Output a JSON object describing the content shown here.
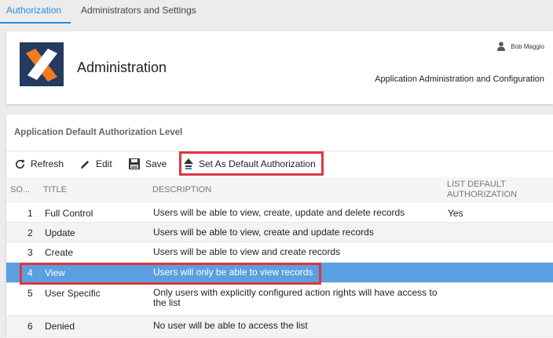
{
  "tabs": [
    {
      "label": "Authorization",
      "active": true
    },
    {
      "label": "Administrators and Settings",
      "active": false
    }
  ],
  "header": {
    "title": "Administration",
    "user": "Bob Maggio",
    "subtitle": "Application Administration and Configuration",
    "logo": {
      "background": "#243a5e",
      "accent": "#f47a20"
    }
  },
  "section": {
    "title": "Application Default Authorization Level"
  },
  "toolbar": {
    "refresh": "Refresh",
    "edit": "Edit",
    "save": "Save",
    "set_default": "Set As Default Authorization"
  },
  "table": {
    "columns": {
      "so": "SO...",
      "title": "TITLE",
      "description": "DESCRIPTION",
      "list_default_1": "LIST DEFAULT",
      "list_default_2": "AUTHORIZATION"
    },
    "rows": [
      {
        "so": "1",
        "title": "Full Control",
        "description": "Users will be able to view, create, update and delete records",
        "list_default": "Yes"
      },
      {
        "so": "2",
        "title": "Update",
        "description": "Users will be able to view, create and update records",
        "list_default": ""
      },
      {
        "so": "3",
        "title": "Create",
        "description": "Users will be able to view and create records",
        "list_default": ""
      },
      {
        "so": "4",
        "title": "View",
        "description": "Users will only be able to view records",
        "list_default": "",
        "selected": true
      },
      {
        "so": "5",
        "title": "User Specific",
        "description": "Only users with explicitly configured action rights will have access to the list",
        "list_default": ""
      },
      {
        "so": "6",
        "title": "Denied",
        "description": "No user will be able to access the list",
        "list_default": ""
      }
    ]
  },
  "colors": {
    "accent": "#2d8ad8",
    "selected_row": "#5a9fe0",
    "highlight": "#e0353f"
  }
}
